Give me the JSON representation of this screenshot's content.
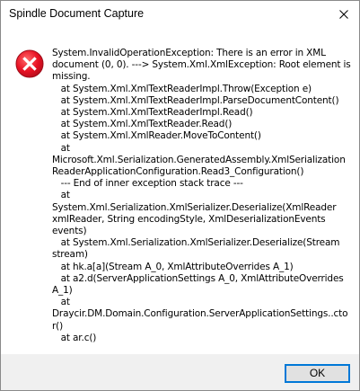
{
  "window": {
    "title": "Spindle Document Capture",
    "close_icon": "close-icon"
  },
  "dialog": {
    "icon": "error-icon",
    "icon_color": "#e81123",
    "message": "System.InvalidOperationException: There is an error in XML document (0, 0). ---> System.Xml.XmlException: Root element is missing.\n   at System.Xml.XmlTextReaderImpl.Throw(Exception e)\n   at System.Xml.XmlTextReaderImpl.ParseDocumentContent()\n   at System.Xml.XmlTextReaderImpl.Read()\n   at System.Xml.XmlTextReader.Read()\n   at System.Xml.XmlReader.MoveToContent()\n   at Microsoft.Xml.Serialization.GeneratedAssembly.XmlSerializationReaderApplicationConfiguration.Read3_Configuration()\n   --- End of inner exception stack trace ---\n   at System.Xml.Serialization.XmlSerializer.Deserialize(XmlReader xmlReader, String encodingStyle, XmlDeserializationEvents events)\n   at System.Xml.Serialization.XmlSerializer.Deserialize(Stream stream)\n   at hk.a[a](Stream A_0, XmlAttributeOverrides A_1)\n   at a2.d(ServerApplicationSettings A_0, XmlAttributeOverrides A_1)\n   at Draycir.DM.Domain.Configuration.ServerApplicationSettings..ctor()\n   at ar.c()"
  },
  "footer": {
    "ok_label": "OK"
  },
  "colors": {
    "footer_background": "#f0f0f0",
    "button_focus_border": "#0078d7",
    "button_background": "#e1e1e1"
  }
}
